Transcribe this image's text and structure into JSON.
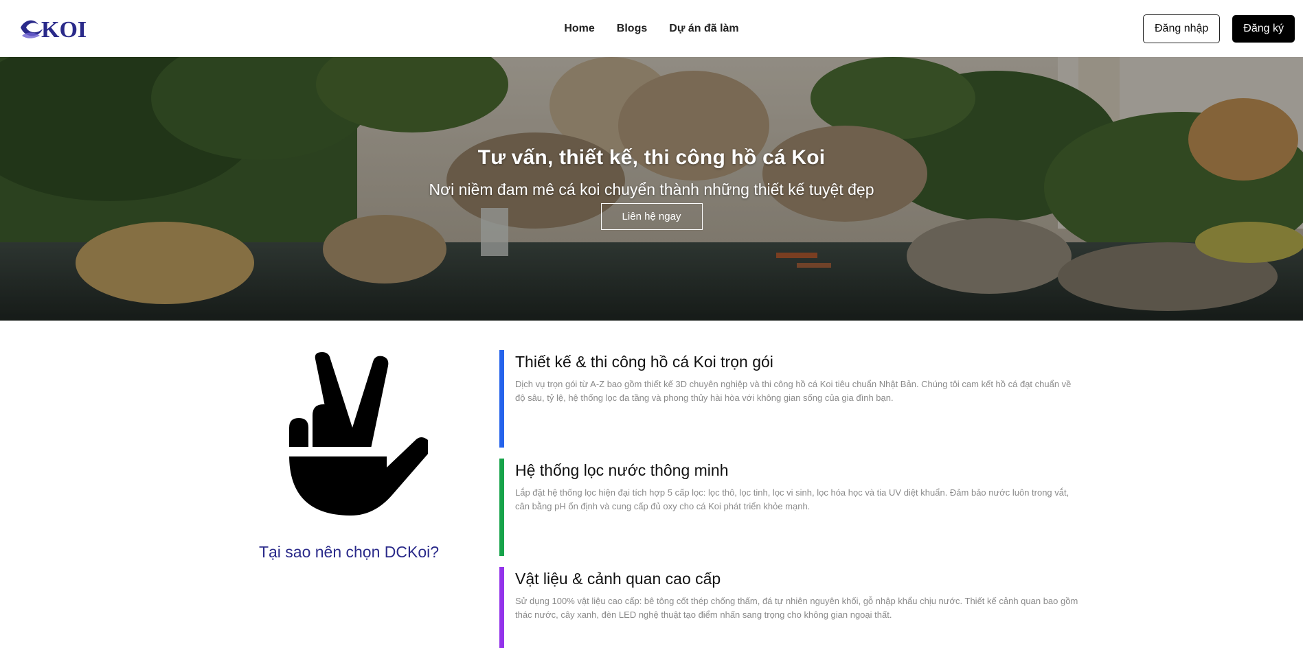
{
  "brand": {
    "logo_text": "KOI"
  },
  "nav": {
    "links": [
      {
        "label": "Home"
      },
      {
        "label": "Blogs"
      },
      {
        "label": "Dự án đã làm"
      }
    ],
    "login_label": "Đăng nhập",
    "register_label": "Đăng ký"
  },
  "hero": {
    "title": "Tư vấn, thiết kế, thi công hồ cá Koi",
    "subtitle": "Nơi niềm đam mê cá koi chuyển thành những thiết kế tuyệt đẹp",
    "cta_label": "Liên hệ ngay"
  },
  "why": {
    "icon": "victory-hand-icon",
    "heading": "Tại sao nên chọn DCKoi?"
  },
  "features": [
    {
      "title": "Thiết kế & thi công hồ cá Koi trọn gói",
      "description": "Dịch vụ trọn gói từ A-Z bao gồm thiết kế 3D chuyên nghiệp và thi công hồ cá Koi tiêu chuẩn Nhật Bản. Chúng tôi cam kết hồ cá đạt chuẩn về độ sâu, tỷ lệ, hệ thống lọc đa tầng và phong thủy hài hòa với không gian sống của gia đình bạn.",
      "accent": "#2563eb"
    },
    {
      "title": "Hệ thống lọc nước thông minh",
      "description": "Lắp đặt hệ thống lọc hiện đại tích hợp 5 cấp lọc: lọc thô, lọc tinh, lọc vi sinh, lọc hóa học và tia UV diệt khuẩn. Đảm bảo nước luôn trong vắt, cân bằng pH ổn định và cung cấp đủ oxy cho cá Koi phát triển khỏe mạnh.",
      "accent": "#16a34a"
    },
    {
      "title": "Vật liệu & cảnh quan cao cấp",
      "description": "Sử dụng 100% vật liệu cao cấp: bê tông cốt thép chống thấm, đá tự nhiên nguyên khối, gỗ nhập khẩu chịu nước. Thiết kế cảnh quan bao gồm thác nước, cây xanh, đèn LED nghệ thuật tạo điểm nhấn sang trọng cho không gian ngoại thất.",
      "accent": "#9333ea"
    }
  ]
}
